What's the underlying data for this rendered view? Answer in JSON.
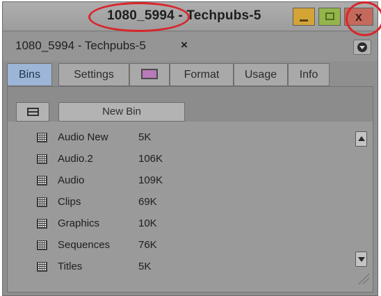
{
  "window": {
    "title": "1080_5994 - Techpubs-5",
    "buttons": {
      "minimize_icon": "minimize-icon",
      "maximize_icon": "maximize-icon",
      "close_icon": "close-icon",
      "close_glyph": "x"
    }
  },
  "bin_tab": {
    "label": "1080_5994 - Techpubs-5",
    "close_glyph": "×",
    "menu_icon": "fast-menu-icon"
  },
  "subtabs": [
    {
      "label": "Bins",
      "active": true
    },
    {
      "label": "Settings",
      "active": false
    },
    {
      "label": "",
      "icon": "color-swatch-icon",
      "active": false
    },
    {
      "label": "Format",
      "active": false
    },
    {
      "label": "Usage",
      "active": false
    },
    {
      "label": "Info",
      "active": false
    }
  ],
  "toolbar": {
    "view_icon": "list-view-icon",
    "new_bin_label": "New Bin"
  },
  "bins": [
    {
      "name": "Audio New",
      "size": "5K"
    },
    {
      "name": "Audio.2",
      "size": "106K"
    },
    {
      "name": "Audio",
      "size": "109K"
    },
    {
      "name": "Clips",
      "size": "69K"
    },
    {
      "name": "Graphics",
      "size": "10K"
    },
    {
      "name": "Sequences",
      "size": "76K"
    },
    {
      "name": "Titles",
      "size": "5K"
    }
  ],
  "colors": {
    "annotation": "#d8262a",
    "active_tab": "#9db5d6",
    "minimize": "#d4a437",
    "maximize": "#93b54a",
    "close": "#c46a5c"
  }
}
